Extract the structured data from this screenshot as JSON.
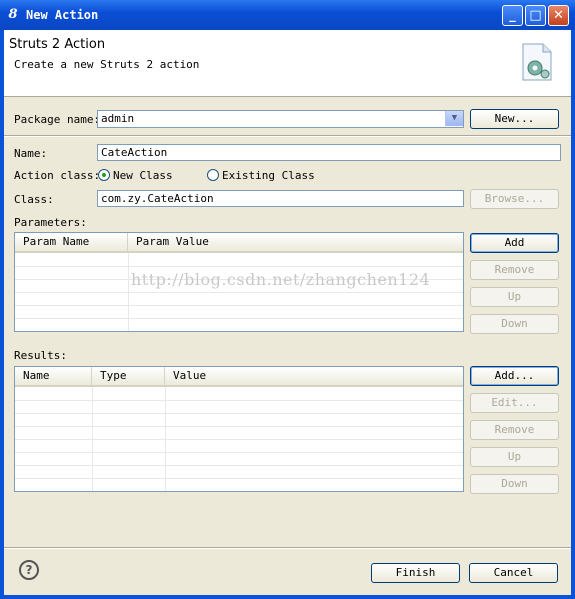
{
  "window": {
    "title": "New Action",
    "buttons": {
      "minimize": "_",
      "maximize": "□",
      "close": "✕"
    }
  },
  "banner": {
    "title": "Struts 2 Action",
    "description": "Create a new Struts 2 action"
  },
  "form": {
    "package_label": "Package name:",
    "package_value": "admin",
    "package_new_button": "New...",
    "name_label": "Name:",
    "name_value": "CateAction",
    "action_class_label": "Action class:",
    "radio_new": "New Class",
    "radio_existing": "Existing Class",
    "class_label": "Class:",
    "class_value": "com.zy.CateAction",
    "browse_button": "Browse..."
  },
  "parameters": {
    "label": "Parameters:",
    "columns": [
      "Param Name",
      "Param Value"
    ],
    "buttons": {
      "add": "Add",
      "remove": "Remove",
      "up": "Up",
      "down": "Down"
    }
  },
  "results": {
    "label": "Results:",
    "columns": [
      "Name",
      "Type",
      "Value"
    ],
    "buttons": {
      "add": "Add...",
      "edit": "Edit...",
      "remove": "Remove",
      "up": "Up",
      "down": "Down"
    }
  },
  "watermark": "http://blog.csdn.net/zhangchen124",
  "footer": {
    "help": "?",
    "finish": "Finish",
    "cancel": "Cancel"
  }
}
